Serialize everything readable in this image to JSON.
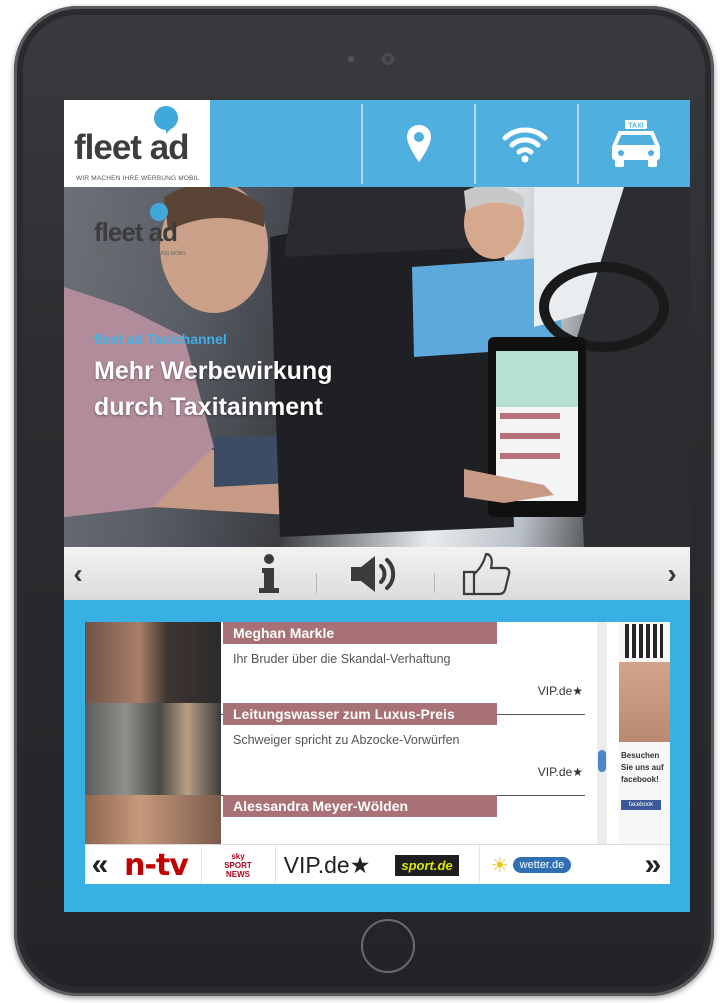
{
  "header": {
    "logo_text": "fleet ad",
    "logo_tagline": "WIR MACHEN IHRE WERBUNG MOBIL",
    "icons": [
      "location-pin-icon",
      "wifi-icon",
      "taxi-icon"
    ],
    "taxi_sign": "TAXI",
    "color": "#4fb0e0"
  },
  "hero": {
    "logo_text": "fleet ad",
    "logo_tagline": "WIR MACHEN IHRE WERBUNG MOBIL",
    "kicker": "fleet ad Taxichannel",
    "title_line1": "Mehr Werbewirkung",
    "title_line2": "durch Taxitainment"
  },
  "controls": {
    "prev": "‹",
    "next": "›",
    "icons": [
      "info-icon",
      "speaker-icon",
      "thumbs-up-icon"
    ]
  },
  "news": {
    "items": [
      {
        "title": "Meghan Markle",
        "subtitle": "Ihr Bruder über die Skandal-Verhaftung",
        "source": "VIP.de★"
      },
      {
        "title": "Leitungswasser zum Luxus-Preis",
        "subtitle": "Schweiger spricht zu Abzocke-Vorwürfen",
        "source": "VIP.de★"
      },
      {
        "title": "Alessandra Meyer-Wölden",
        "subtitle": "",
        "source": ""
      }
    ],
    "side_text": "Besuchen Sie uns auf facebook!",
    "facebook_label": "facebook",
    "frame_color": "#38b0e4"
  },
  "channels": {
    "prev": "«",
    "next": "»",
    "items": [
      "n-tv",
      "sky SPORT NEWS",
      "VIP.de★",
      "sport.de",
      "wetter.de"
    ]
  }
}
